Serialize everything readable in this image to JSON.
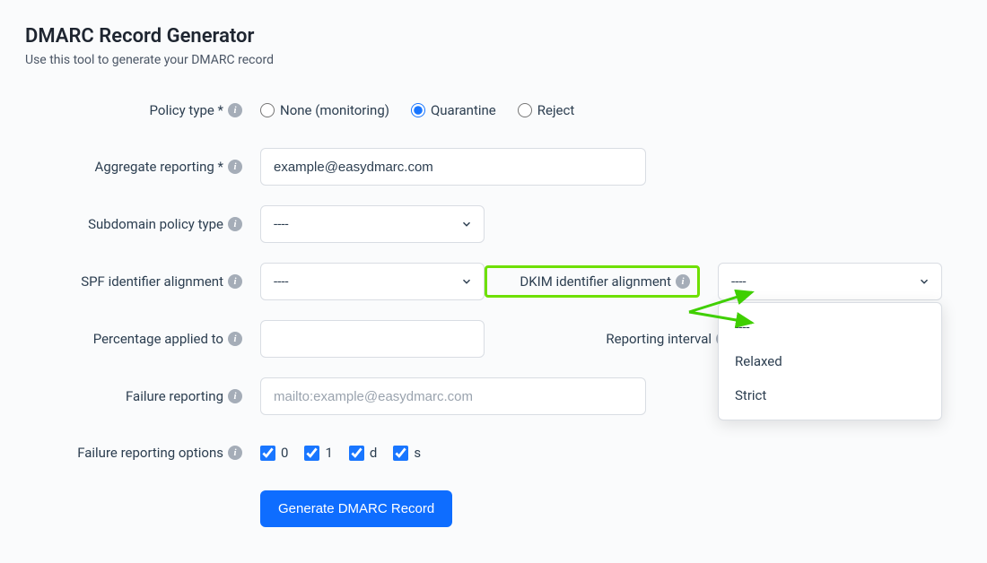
{
  "title": "DMARC Record Generator",
  "subtitle": "Use this tool to generate your DMARC record",
  "labels": {
    "policy_type": "Policy type *",
    "aggregate_reporting": "Aggregate reporting *",
    "subdomain_policy": "Subdomain policy type",
    "spf_alignment": "SPF identifier alignment",
    "dkim_alignment": "DKIM identifier alignment",
    "percentage": "Percentage applied to",
    "reporting_interval": "Reporting interval",
    "failure_reporting": "Failure reporting",
    "failure_options": "Failure reporting options"
  },
  "policy_type": {
    "options": {
      "none": "None (monitoring)",
      "quarantine": "Quarantine",
      "reject": "Reject"
    },
    "selected": "quarantine"
  },
  "aggregate_reporting": {
    "value": "example@easydmarc.com"
  },
  "subdomain_policy": {
    "placeholder": "----"
  },
  "spf_alignment": {
    "placeholder": "----"
  },
  "dkim_alignment": {
    "placeholder": "----",
    "dropdown_options": [
      "----",
      "Relaxed",
      "Strict"
    ]
  },
  "percentage": {
    "value": ""
  },
  "reporting_interval": {
    "value": ""
  },
  "failure_reporting": {
    "placeholder": "mailto:example@easydmarc.com",
    "value": ""
  },
  "failure_options": {
    "items": [
      {
        "label": "0",
        "checked": true
      },
      {
        "label": "1",
        "checked": true
      },
      {
        "label": "d",
        "checked": true
      },
      {
        "label": "s",
        "checked": true
      }
    ]
  },
  "submit_label": "Generate DMARC Record"
}
